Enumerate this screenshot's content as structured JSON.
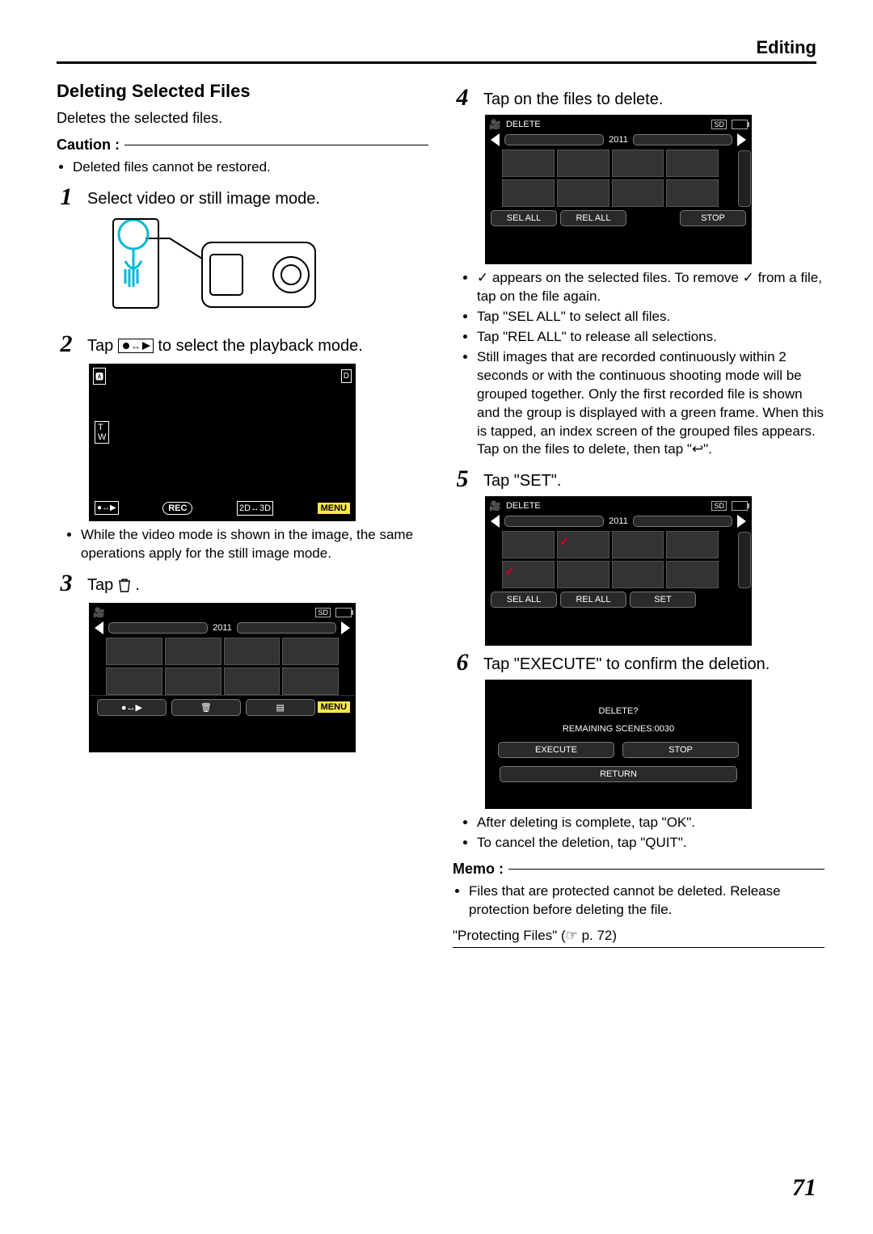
{
  "header": {
    "chapter": "Editing"
  },
  "page_number": "71",
  "left": {
    "heading": "Deleting Selected Files",
    "intro": "Deletes the selected files.",
    "caution_label": "Caution :",
    "caution_items": [
      "Deleted files cannot be restored."
    ],
    "step1": {
      "num": "1",
      "text": "Select video or still image mode."
    },
    "step2": {
      "num": "2",
      "text_pre": "Tap ",
      "text_post": " to select the playback mode."
    },
    "step2_notes": [
      "While the video mode is shown in the image, the same operations apply for the still image mode."
    ],
    "step3": {
      "num": "3",
      "text_pre": "Tap ",
      "text_post": "."
    },
    "rec_screen": {
      "rec_label": "REC",
      "menu_label": "MENU",
      "t_label": "T",
      "w_label": "W",
      "mode_label": "D",
      "threeD_label": "2D↔3D"
    },
    "thumb_screen": {
      "year": "2011",
      "menu_label": "MENU"
    }
  },
  "right": {
    "step4": {
      "num": "4",
      "text": "Tap on the files to delete."
    },
    "delete_screen1": {
      "title": "DELETE",
      "year": "2011",
      "sd_label": "SD",
      "sel_all": "SEL ALL",
      "rel_all": "REL ALL",
      "stop": "STOP"
    },
    "step4_notes": [
      "✓ appears on the selected files. To remove ✓ from a file, tap on the file again.",
      "Tap \"SEL ALL\" to select all files.",
      "Tap \"REL ALL\" to release all selections.",
      "Still images that are recorded continuously within 2 seconds or with the continuous shooting mode will be grouped together. Only the first recorded file is shown and the group is displayed with a green frame. When this is tapped, an index screen of the grouped files appears. Tap on the files to delete, then tap \"↩\"."
    ],
    "step5": {
      "num": "5",
      "text": "Tap \"SET\"."
    },
    "delete_screen2": {
      "title": "DELETE",
      "year": "2011",
      "sd_label": "SD",
      "sel_all": "SEL ALL",
      "rel_all": "REL ALL",
      "set": "SET"
    },
    "step6": {
      "num": "6",
      "text": "Tap \"EXECUTE\" to confirm the deletion."
    },
    "confirm_screen": {
      "prompt": "DELETE?",
      "remaining": "REMAINING SCENES:0030",
      "execute": "EXECUTE",
      "stop": "STOP",
      "return": "RETURN"
    },
    "step6_notes": [
      "After deleting is complete, tap \"OK\".",
      "To cancel the deletion, tap \"QUIT\"."
    ],
    "memo_label": "Memo :",
    "memo_items": [
      "Files that are protected cannot be deleted. Release protection before deleting the file."
    ],
    "cross_ref": "\"Protecting Files\" (☞ p. 72)"
  }
}
